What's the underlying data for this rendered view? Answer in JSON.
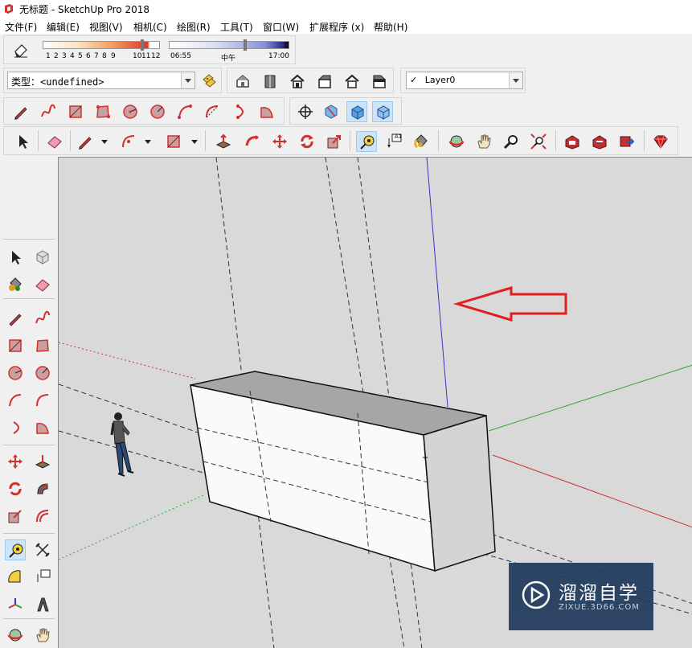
{
  "window": {
    "title": "无标题 - SketchUp Pro 2018"
  },
  "menu": [
    "文件(F)",
    "编辑(E)",
    "视图(V)",
    "相机(C)",
    "绘图(R)",
    "工具(T)",
    "窗口(W)",
    "扩展程序 (x)",
    "帮助(H)"
  ],
  "shadow_settings": {
    "month_ticks": [
      "1",
      "2",
      "3",
      "4",
      "5",
      "6",
      "7",
      "8",
      "9",
      "10",
      "11",
      "12"
    ],
    "time_start": "06:55",
    "time_mid": "中午",
    "time_end": "17:00"
  },
  "entity_info": {
    "type_label": "类型：",
    "type_value": "<undefined>"
  },
  "layers": {
    "check": "✓",
    "current_layer": "Layer0"
  },
  "text_tool_label": "A1",
  "watermark": {
    "main": "溜溜自学",
    "sub": "ZIXUE.3D66.COM"
  },
  "colors": {
    "tool_red": "#d03030",
    "viewport_bg": "#d9d9d9",
    "axis_red": "#cc3333",
    "axis_green": "#33aa33",
    "axis_blue": "#3333cc",
    "arrow_red": "#e02020",
    "active_tool": "#cce4f7"
  }
}
